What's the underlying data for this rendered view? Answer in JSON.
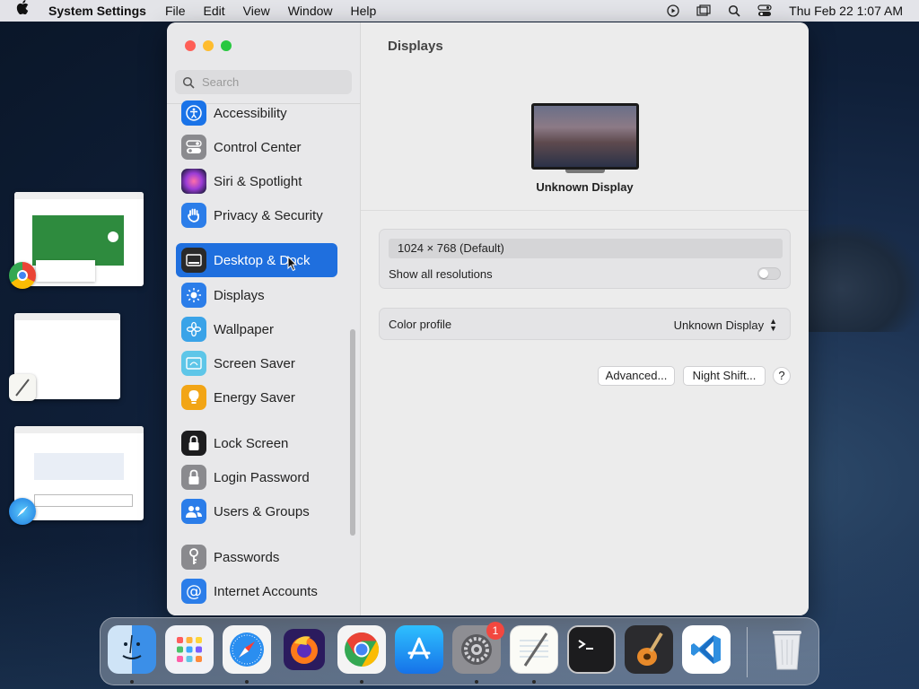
{
  "menubar": {
    "app_name": "System Settings",
    "menus": [
      "File",
      "Edit",
      "View",
      "Window",
      "Help"
    ],
    "clock": "Thu Feb 22  1:07 AM",
    "status_icons": [
      "play-circle-icon",
      "window-icon",
      "search-icon",
      "control-center-icon"
    ]
  },
  "sidebar": {
    "search_placeholder": "Search",
    "items": [
      {
        "label": "Accessibility",
        "icon": "accessibility-icon",
        "color": "#1a73e8"
      },
      {
        "label": "Control Center",
        "icon": "control-center-icon",
        "color": "#8a8a8e"
      },
      {
        "label": "Siri & Spotlight",
        "icon": "siri-icon",
        "color": "#9b3cd6"
      },
      {
        "label": "Privacy & Security",
        "icon": "hand-icon",
        "color": "#2b7de9"
      },
      {
        "label": "Desktop & Dock",
        "icon": "dock-icon",
        "color": "#2a2a2a"
      },
      {
        "label": "Displays",
        "icon": "sun-icon",
        "color": "#2b7de9"
      },
      {
        "label": "Wallpaper",
        "icon": "flower-icon",
        "color": "#3aa3e8"
      },
      {
        "label": "Screen Saver",
        "icon": "screen-saver-icon",
        "color": "#5ec6e8"
      },
      {
        "label": "Energy Saver",
        "icon": "bulb-icon",
        "color": "#f2a516"
      },
      {
        "label": "Lock Screen",
        "icon": "lock-icon",
        "color": "#1c1c1e"
      },
      {
        "label": "Login Password",
        "icon": "padlock-icon",
        "color": "#8a8a8e"
      },
      {
        "label": "Users & Groups",
        "icon": "users-icon",
        "color": "#2b7de9"
      },
      {
        "label": "Passwords",
        "icon": "key-icon",
        "color": "#8a8a8e"
      },
      {
        "label": "Internet Accounts",
        "icon": "at-icon",
        "color": "#2b7de9"
      }
    ],
    "selected": "Desktop & Dock"
  },
  "content": {
    "title": "Displays",
    "display_name": "Unknown Display",
    "resolution": "1024 × 768 (Default)",
    "show_all_resolutions_label": "Show all resolutions",
    "show_all_resolutions_on": false,
    "color_profile_label": "Color profile",
    "color_profile_value": "Unknown Display",
    "advanced_label": "Advanced...",
    "night_shift_label": "Night Shift...",
    "help_label": "?"
  },
  "dock": {
    "apps": [
      "Finder",
      "Launchpad",
      "Safari",
      "Firefox",
      "Chrome",
      "App Store",
      "System Settings",
      "TextEdit",
      "Terminal",
      "GarageBand",
      "Visual Studio Code",
      "Trash"
    ],
    "system_settings_badge": "1"
  }
}
